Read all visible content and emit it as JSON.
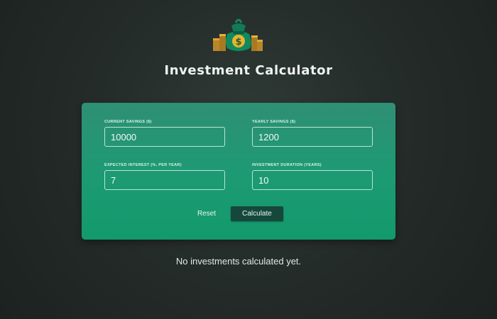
{
  "header": {
    "logo": "money-bag-icon",
    "title": "Investment Calculator"
  },
  "form": {
    "fields": [
      {
        "label": "CURRENT SAVINGS ($)",
        "value": "10000"
      },
      {
        "label": "YEARLY SAVINGS ($)",
        "value": "1200"
      },
      {
        "label": "EXPECTED INTEREST (%, PER YEAR)",
        "value": "7"
      },
      {
        "label": "INVESTMENT DURATION (YEARS)",
        "value": "10"
      }
    ],
    "reset_label": "Reset",
    "calculate_label": "Calculate"
  },
  "results": {
    "empty_message": "No investments calculated yet."
  },
  "colors": {
    "background": "#252c2a",
    "card": "#1e9a73",
    "button": "#15483a",
    "coin": "#e0a82e"
  }
}
